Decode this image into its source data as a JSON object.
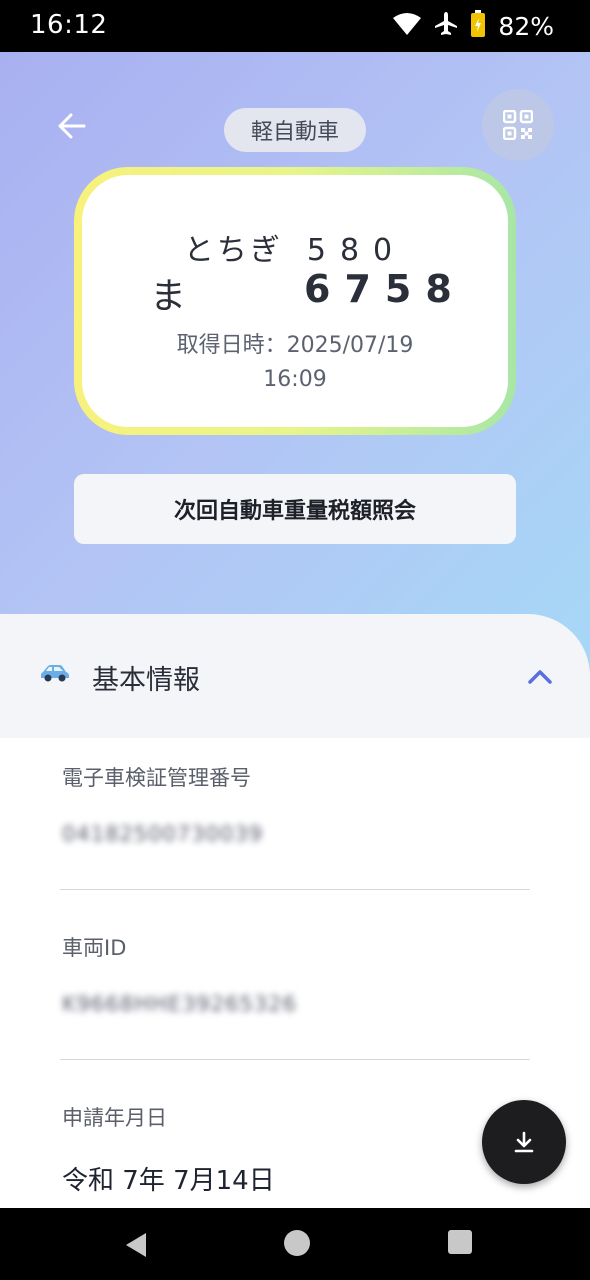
{
  "status_bar": {
    "time": "16:12",
    "battery_percent": "82%",
    "icons": [
      "wifi-icon",
      "airplane-icon",
      "battery-charging-icon"
    ]
  },
  "header": {
    "vehicle_type": "軽自動車",
    "back_icon": "arrow-left-icon",
    "qr_icon": "qr-code-icon"
  },
  "plate": {
    "region": "とちぎ",
    "class_number": "580",
    "hiragana": "ま",
    "number": "6758",
    "acquired_line1": "取得日時：2025/07/19",
    "acquired_line2": "16:09"
  },
  "tax_button": {
    "label": "次回自動車重量税額照会"
  },
  "section": {
    "title": "基本情報",
    "icon": "car-icon",
    "toggle_icon": "chevron-up-icon"
  },
  "fields": [
    {
      "label": "電子車検証管理番号",
      "value": "04182500730039",
      "blurred": true
    },
    {
      "label": "車両ID",
      "value": "K9668HHE39265326",
      "blurred": true
    },
    {
      "label": "申請年月日",
      "value": "令和 7年 7月14日",
      "blurred": false
    }
  ],
  "fab": {
    "icon": "download-icon"
  },
  "colors": {
    "hero_gradient_start": "#a9b0f1",
    "hero_gradient_end": "#a6d8f6",
    "plate_frame_yellow": "#f8f17c",
    "plate_frame_green": "#a8e6a6",
    "accent_blue": "#5b6ee1",
    "car_icon_blue": "#6aaee6",
    "fab_bg": "#1d1d1f"
  },
  "nav_bar": {
    "icons": [
      "nav-back-icon",
      "nav-home-icon",
      "nav-recents-icon"
    ]
  }
}
